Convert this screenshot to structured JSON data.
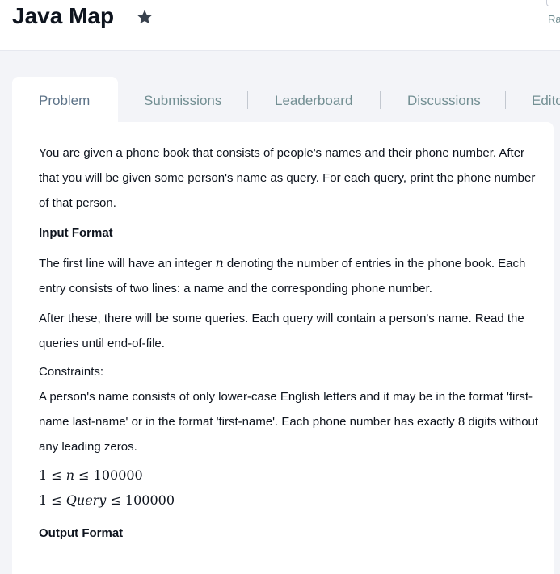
{
  "header": {
    "title": "Java Map",
    "corner_label": "Ra"
  },
  "tabs": [
    {
      "label": "Problem",
      "active": true
    },
    {
      "label": "Submissions",
      "active": false
    },
    {
      "label": "Leaderboard",
      "active": false
    },
    {
      "label": "Discussions",
      "active": false
    },
    {
      "label": "Edito",
      "active": false
    }
  ],
  "problem": {
    "intro": "You are given a phone book that consists of people's names and their phone number. After that you will be given some person's name as query. For each query, print the phone number of that person.",
    "input_heading": "Input Format",
    "input_line1_pre": "The first line will have an integer ",
    "input_var": "n",
    "input_line1_post": " denoting the number of entries in the phone book. Each entry consists of two lines: a name and the corresponding phone number.",
    "input_line2": "After these, there will be some queries. Each query will contain a person's name. Read the queries until end-of-file.",
    "constraints_heading": "Constraints:",
    "constraints_text": "A person's name consists of only lower-case English letters and it may be in the format 'first-name last-name' or in the format 'first-name'. Each phone number has exactly 8 digits without any leading zeros.",
    "constraint1": {
      "low": "1",
      "var": "n",
      "high": "100000"
    },
    "constraint2": {
      "low": "1",
      "var": "Query",
      "high": "100000"
    },
    "output_heading": "Output Format"
  },
  "colors": {
    "title": "#0e141e",
    "tab_text": "#738f93",
    "page_bg": "#f3f4f8",
    "panel_bg": "#ffffff"
  },
  "icons": {
    "star": "star-icon"
  }
}
